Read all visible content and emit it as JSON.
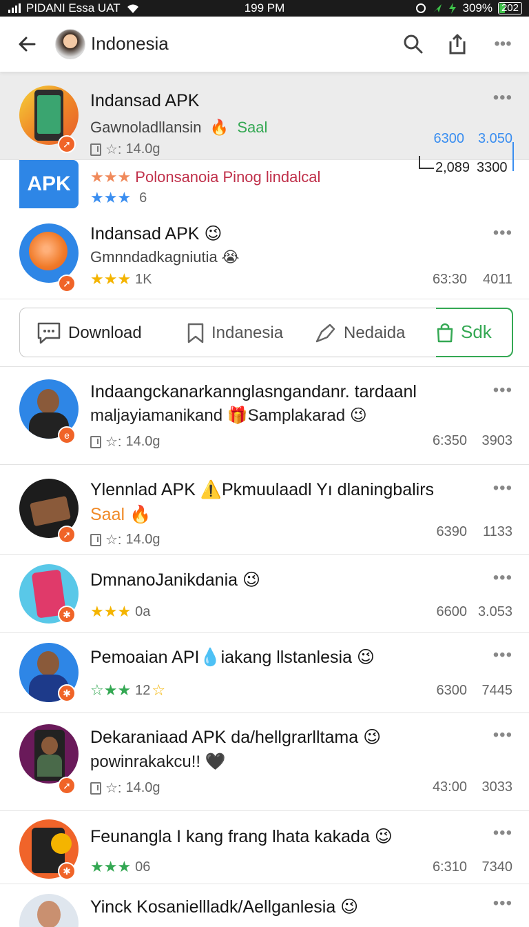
{
  "status_bar": {
    "carrier": "PIDANI Essa UAT",
    "time": "199 PM",
    "battery_pct": "309%",
    "battery_label": "202"
  },
  "header": {
    "title": "Indonesia"
  },
  "featured": [
    {
      "title": "Indansad APK",
      "subtitle": "Gawnoladllansin",
      "tag": "Saal",
      "meta": "14.0g",
      "stat_a": "6300",
      "stat_b": "3.050",
      "stat_c": "2,089",
      "stat_d": "3300"
    },
    {
      "badge_text": "APK",
      "subtitle": "Polonsanoia Pinog lindalcal",
      "rating": "6"
    }
  ],
  "apps_top": [
    {
      "title": "Indansad APK",
      "subtitle": "Gmnndadkagniutia",
      "rating": "1K",
      "stat_a": "63:30",
      "stat_b": "4011"
    }
  ],
  "tabs": [
    {
      "label": "Download"
    },
    {
      "label": "Indanesia"
    },
    {
      "label": "Nedaida"
    },
    {
      "label": "Sdk"
    }
  ],
  "apps": [
    {
      "title": "Indaangckanarkannglasngandanr. tardaanl",
      "subtitle": "maljayiamanikand",
      "subtitle2": "Samplakarad",
      "meta": "14.0g",
      "stat_a": "6:350",
      "stat_b": "3903"
    },
    {
      "title": "Ylennlad APK",
      "title2": "Pkmuulaadl Yı dlaningbalirs",
      "tag": "Saal",
      "meta": "14.0g",
      "stat_a": "6390",
      "stat_b": "1133"
    },
    {
      "title": "DmnanoJanikdania",
      "rating": "0a",
      "stat_a": "6600",
      "stat_b": "3.053"
    },
    {
      "title": "Pemoaian API",
      "title2": "iakang llstanlesia",
      "rating": "12",
      "stat_a": "6300",
      "stat_b": "7445"
    },
    {
      "title": "Dekaraniaad APK da/hellgrarlltama",
      "subtitle": "powinrakakcu!!",
      "meta": "14.0g",
      "stat_a": "43:00",
      "stat_b": "3033"
    },
    {
      "title": "Feunangla I kang frang lhata kakada",
      "rating": "06",
      "stat_a": "6:310",
      "stat_b": "7340"
    },
    {
      "title": "Yinck Kosaniellladk/Aellganlesia"
    }
  ],
  "colors": {
    "accent_orange": "#f06428",
    "green": "#34a853",
    "blue": "#3a8ef0",
    "star_yellow": "#f4b400"
  },
  "icons": [
    "back-arrow-icon",
    "search-icon",
    "share-icon",
    "more-icon",
    "chat-icon",
    "bookmark-icon",
    "send-icon",
    "rocket-icon"
  ]
}
